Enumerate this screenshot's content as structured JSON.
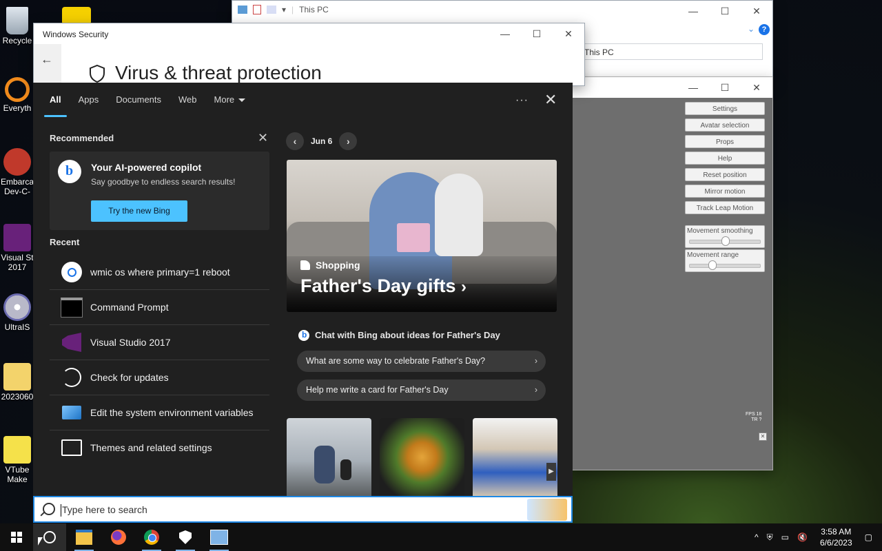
{
  "desktop": {
    "icons": [
      {
        "label": "Recycle",
        "name": "recycle-bin-icon"
      },
      {
        "label": "Everyth",
        "name": "everything-app-icon"
      },
      {
        "label": "Embarca\nDev-C-",
        "name": "devcpp-icon"
      },
      {
        "label": "Visual St\n2017",
        "name": "visual-studio-desktop-icon"
      },
      {
        "label": "UltraIS",
        "name": "ultraiso-icon"
      },
      {
        "label": "2023060",
        "name": "folder-icon"
      },
      {
        "label": "VTube\nMake",
        "name": "vtube-maker-icon"
      }
    ]
  },
  "explorer": {
    "title": "This PC",
    "address": "This PC",
    "help": "?"
  },
  "security": {
    "title": "Windows Security",
    "heading": "Virus & threat protection"
  },
  "vtube": {
    "buttons": [
      "Settings",
      "Avatar selection",
      "Props",
      "Help",
      "Reset position",
      "Mirror motion",
      "Track Leap Motion"
    ],
    "sliders": [
      {
        "label": "Movement smoothing",
        "value": 0.5
      },
      {
        "label": "Movement range",
        "value": 0.3
      }
    ],
    "fps_label": "FPS 18",
    "tr_label": "TR  ?"
  },
  "search": {
    "tabs": [
      "All",
      "Apps",
      "Documents",
      "Web",
      "More"
    ],
    "active_tab": "All",
    "recommended_title": "Recommended",
    "bing_card": {
      "title": "Your AI-powered copilot",
      "subtitle": "Say goodbye to endless search results!",
      "button": "Try the new Bing"
    },
    "recent_title": "Recent",
    "recent": [
      {
        "label": "wmic os where primary=1 reboot",
        "icon": "search-icon"
      },
      {
        "label": "Command Prompt",
        "icon": "command-prompt-icon"
      },
      {
        "label": "Visual Studio 2017",
        "icon": "visual-studio-icon"
      },
      {
        "label": "Check for updates",
        "icon": "sync-icon"
      },
      {
        "label": "Edit the system environment variables",
        "icon": "system-properties-icon"
      },
      {
        "label": "Themes and related settings",
        "icon": "themes-icon"
      }
    ],
    "date": "Jun 6",
    "hero": {
      "category": "Shopping",
      "title": "Father's Day gifts"
    },
    "chat_title": "Chat with Bing about ideas for Father's Day",
    "suggestions": [
      "What are some way to celebrate Father's Day?",
      "Help me write a card for Father's Day"
    ],
    "placeholder": "Type here to search"
  },
  "taskbar": {
    "time": "3:58 AM",
    "date": "6/6/2023"
  },
  "colors": {
    "accent": "#4cc2ff",
    "panel_bg": "#202020",
    "search_border": "#1e88e5"
  }
}
